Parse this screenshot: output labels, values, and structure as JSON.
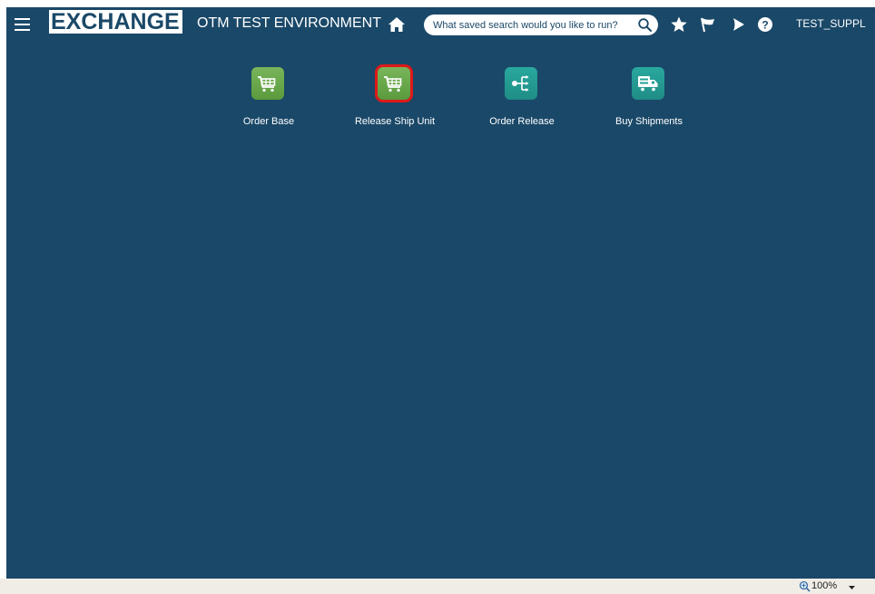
{
  "header": {
    "logo_text": "EXCHANGE",
    "environment_title": "OTM TEST ENVIRONMENT",
    "search_placeholder": "What saved search would you like to run?",
    "user_name": "TEST_SUPPL"
  },
  "tiles": [
    {
      "label": "Order Base",
      "icon": "shopping-cart-icon",
      "color": "#6aaa4b",
      "selected": false
    },
    {
      "label": "Release Ship Unit",
      "icon": "shopping-cart-icon",
      "color": "#6aaa4b",
      "selected": true
    },
    {
      "label": "Order Release",
      "icon": "split-arrows-icon",
      "color": "#25a097",
      "selected": false
    },
    {
      "label": "Buy Shipments",
      "icon": "truck-icon",
      "color": "#25a097",
      "selected": false
    }
  ],
  "statusbar": {
    "zoom": "100%"
  },
  "colors": {
    "background": "#1a4868",
    "selected_outline": "#e01818",
    "statusbar": "#f0ede6"
  }
}
